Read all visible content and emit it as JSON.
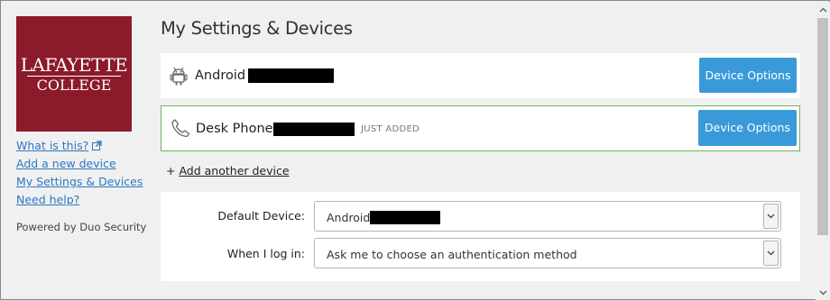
{
  "brand": {
    "logo_line1": "LAFAYETTE",
    "logo_line2": "COLLEGE",
    "color": "#8b1a2b"
  },
  "sidebar": {
    "links": [
      {
        "label": "What is this?",
        "icon": "external-link-icon"
      },
      {
        "label": "Add a new device"
      },
      {
        "label": "My Settings & Devices"
      },
      {
        "label": "Need help?"
      }
    ],
    "powered_by": "Powered by Duo Security"
  },
  "page": {
    "title": "My Settings & Devices"
  },
  "devices": [
    {
      "name": "Android",
      "icon": "android-icon",
      "redacted": true,
      "badge": "",
      "button_label": "Device Options"
    },
    {
      "name": "Desk Phone",
      "icon": "phone-icon",
      "redacted": true,
      "badge": "JUST ADDED",
      "button_label": "Device Options"
    }
  ],
  "add_device": {
    "prefix": "+",
    "label": "Add another device"
  },
  "settings": {
    "default_device": {
      "label": "Default Device:",
      "value": "Android"
    },
    "login_action": {
      "label": "When I log in:",
      "value": "Ask me to choose an authentication method"
    }
  },
  "colors": {
    "accent": "#3a9ad9",
    "link": "#2b78c2",
    "new_device_border": "#71b55b",
    "background": "#f0f0f0"
  }
}
